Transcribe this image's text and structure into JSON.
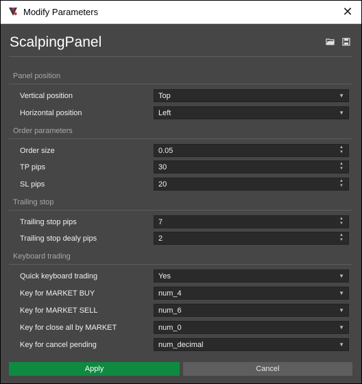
{
  "window": {
    "title": "Modify Parameters",
    "close_glyph": "✕"
  },
  "panel": {
    "title": "ScalpingPanel"
  },
  "icons": {
    "app": "app-logo-icon",
    "load": "folder-open-icon",
    "save": "save-icon"
  },
  "colors": {
    "apply": "#0f8a41",
    "background": "#464646",
    "field": "#2a2a2a"
  },
  "sections": [
    {
      "title": "Panel position",
      "rows": [
        {
          "label": "Vertical position",
          "value": "Top",
          "control": "dropdown"
        },
        {
          "label": "Horizontal position",
          "value": "Left",
          "control": "dropdown"
        }
      ]
    },
    {
      "title": "Order parameters",
      "rows": [
        {
          "label": "Order size",
          "value": "0.05",
          "control": "spinner"
        },
        {
          "label": "TP pips",
          "value": "30",
          "control": "spinner"
        },
        {
          "label": "SL pips",
          "value": "20",
          "control": "spinner"
        }
      ]
    },
    {
      "title": "Trailing stop",
      "rows": [
        {
          "label": "Trailing stop pips",
          "value": "7",
          "control": "spinner"
        },
        {
          "label": "Trailing stop dealy pips",
          "value": "2",
          "control": "spinner"
        }
      ]
    },
    {
      "title": "Keyboard trading",
      "rows": [
        {
          "label": "Quick keyboard trading",
          "value": "Yes",
          "control": "dropdown"
        },
        {
          "label": "Key for MARKET BUY",
          "value": "num_4",
          "control": "dropdown"
        },
        {
          "label": "Key for MARKET SELL",
          "value": "num_6",
          "control": "dropdown"
        },
        {
          "label": "Key for close all by MARKET",
          "value": "num_0",
          "control": "dropdown"
        },
        {
          "label": "Key for cancel pending",
          "value": "num_decimal",
          "control": "dropdown"
        }
      ]
    }
  ],
  "buttons": {
    "apply": "Apply",
    "cancel": "Cancel"
  }
}
